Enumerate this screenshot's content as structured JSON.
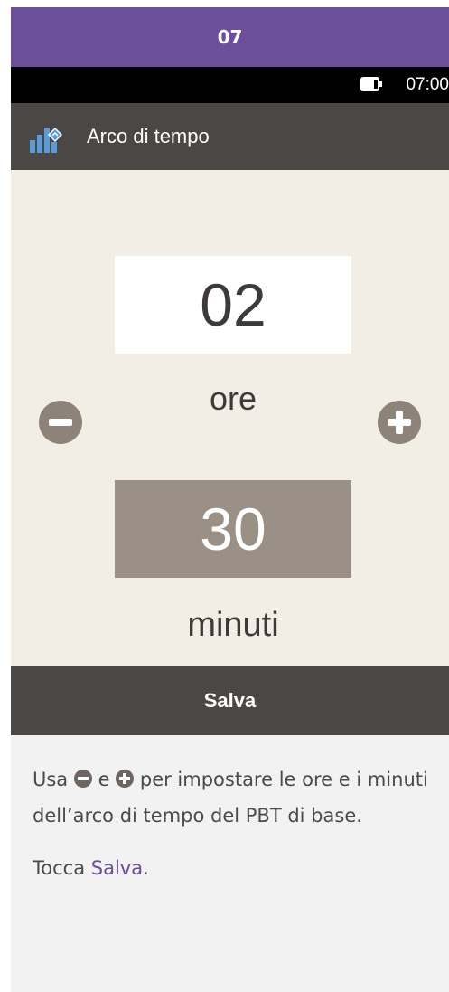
{
  "step_number": "07",
  "status_bar": {
    "time": "07:00"
  },
  "title_bar": {
    "icon": "time-segment-icon",
    "title": "Arco di tempo"
  },
  "time_picker": {
    "hours_value": "02",
    "hours_label": "ore",
    "minutes_value": "30",
    "minutes_label": "minuti",
    "decrement_icon": "minus-circle-icon",
    "increment_icon": "plus-circle-icon"
  },
  "save_button": {
    "label": "Salva"
  },
  "instructions": {
    "line1_part1": "Usa",
    "line1_part2": "e",
    "line1_part3": "per impostare le ore e i minuti dell’arco di tempo del PBT di base.",
    "line2_part1": "Tocca",
    "line2_link": "Salva",
    "line2_part2": "."
  },
  "colors": {
    "header_purple": "#6b4f98",
    "title_bar_dark": "#4a4745",
    "screen_bg": "#f2eee6",
    "selected_field": "#9b9085",
    "button_grey": "#8e8378"
  }
}
